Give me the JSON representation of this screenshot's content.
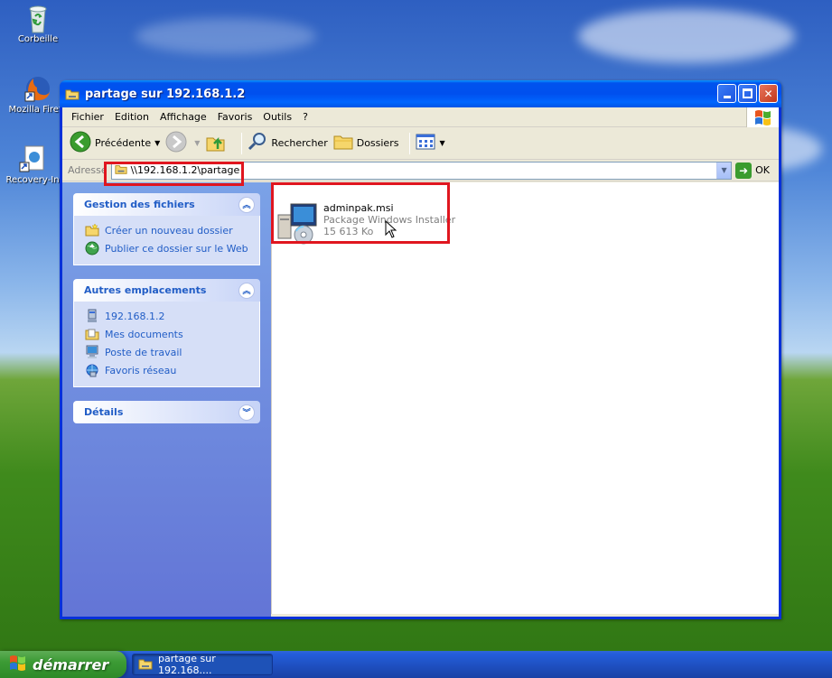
{
  "desktop": {
    "icons": [
      {
        "label": "Corbeille",
        "icon": "recycle-bin-icon"
      },
      {
        "label": "Mozilla Firefo",
        "icon": "firefox-icon"
      },
      {
        "label": "Recovery-In",
        "icon": "shortcut-icon"
      }
    ]
  },
  "window": {
    "title": "partage sur 192.168.1.2",
    "controls": {
      "minimize": "minimize-icon",
      "maximize": "maximize-icon",
      "close": "close-icon"
    }
  },
  "menu": {
    "items": [
      "Fichier",
      "Edition",
      "Affichage",
      "Favoris",
      "Outils",
      "?"
    ]
  },
  "toolbar": {
    "back_label": "Précédente",
    "search_label": "Rechercher",
    "folders_label": "Dossiers"
  },
  "address": {
    "label": "Adresse",
    "value": "\\\\192.168.1.2\\partage",
    "go_label": "OK"
  },
  "tasks": {
    "file_tasks": {
      "title": "Gestion des fichiers",
      "links": [
        "Créer un nouveau dossier",
        "Publier ce dossier sur le Web"
      ]
    },
    "other_places": {
      "title": "Autres emplacements",
      "links": [
        "192.168.1.2",
        "Mes documents",
        "Poste de travail",
        "Favoris réseau"
      ]
    },
    "details": {
      "title": "Détails"
    }
  },
  "files": [
    {
      "name": "adminpak.msi",
      "type": "Package Windows Installer",
      "size": "15 613 Ko",
      "icon": "windows-installer-icon"
    }
  ],
  "taskbar": {
    "start_label": "démarrer",
    "task_label": "partage sur 192.168...."
  },
  "colors": {
    "title_blue": "#0053ee",
    "highlight_red": "#e0161f",
    "task_link": "#215dc6"
  }
}
